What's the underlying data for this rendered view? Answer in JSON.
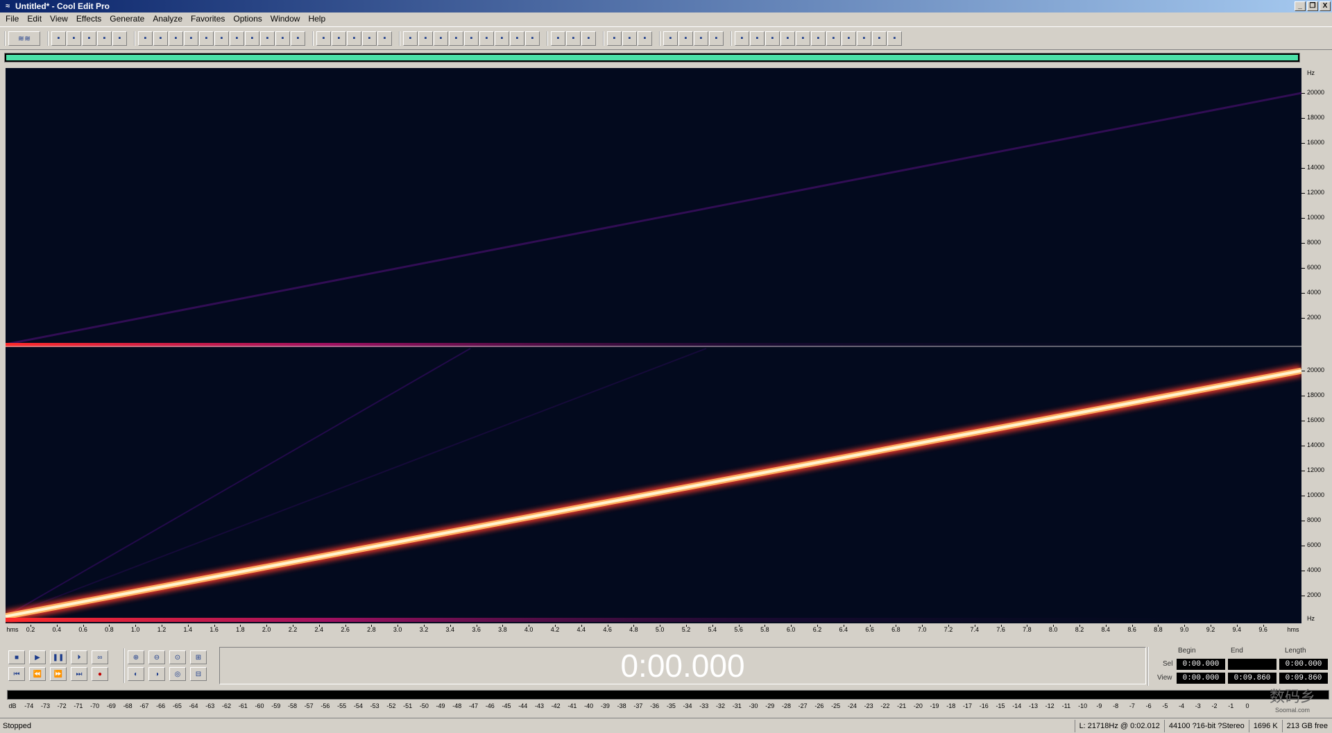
{
  "window": {
    "title": "Untitled* - Cool Edit Pro",
    "minimize_label": "_",
    "restore_label": "❐",
    "close_label": "X"
  },
  "menu": [
    "File",
    "Edit",
    "View",
    "Effects",
    "Generate",
    "Analyze",
    "Favorites",
    "Options",
    "Window",
    "Help"
  ],
  "toolbar_icons": [
    "waveform-view-icon",
    "new-file-icon",
    "open-file-icon",
    "save-icon",
    "save-all-icon",
    "close-file-icon",
    "undo-icon",
    "redo-icon",
    "cut-icon",
    "copy-icon",
    "paste-icon",
    "mix-paste-icon",
    "trim-icon",
    "select-all-icon",
    "zoom-selection-icon",
    "crop-icon",
    "play-selection-icon",
    "spectral-view-icon",
    "envelope-icon",
    "snap-icon",
    "grid-icon",
    "cue-icon",
    "marker-icon",
    "region-icon",
    "stretch-icon",
    "play-icon",
    "loop-icon",
    "time-icon",
    "frame-icon",
    "meter-icon",
    "monitor-icon",
    "script-icon",
    "batch-icon",
    "help-icon",
    "list-icon",
    "scan-icon",
    "find-icon",
    "mixer-icon",
    "eq-icon",
    "filter-icon",
    "noise-icon",
    "amplify-icon",
    "fade-icon",
    "normalize-icon",
    "delay-icon",
    "reverb-icon",
    "pitch-icon",
    "bend-icon",
    "sweep-icon",
    "invert-icon",
    "reverse-icon",
    "silence-icon"
  ],
  "frequency_scale": {
    "unit": "Hz",
    "top_channel": [
      "20000",
      "18000",
      "16000",
      "14000",
      "12000",
      "10000",
      "8000",
      "6000",
      "4000",
      "2000"
    ],
    "bottom_channel": [
      "20000",
      "18000",
      "16000",
      "14000",
      "12000",
      "10000",
      "8000",
      "6000",
      "4000",
      "2000"
    ]
  },
  "time_ruler": {
    "start_label": "hms",
    "end_label": "hms",
    "labels": [
      "0.2",
      "0.4",
      "0.6",
      "0.8",
      "1.0",
      "1.2",
      "1.4",
      "1.6",
      "1.8",
      "2.0",
      "2.2",
      "2.4",
      "2.6",
      "2.8",
      "3.0",
      "3.2",
      "3.4",
      "3.6",
      "3.8",
      "4.0",
      "4.2",
      "4.4",
      "4.6",
      "4.8",
      "5.0",
      "5.2",
      "5.4",
      "5.6",
      "5.8",
      "6.0",
      "6.2",
      "6.4",
      "6.6",
      "6.8",
      "7.0",
      "7.2",
      "7.4",
      "7.6",
      "7.8",
      "8.0",
      "8.2",
      "8.4",
      "8.6",
      "8.8",
      "9.0",
      "9.2",
      "9.4",
      "9.6"
    ]
  },
  "transport": {
    "row1": [
      "stop-icon",
      "play-icon",
      "pause-icon",
      "play-to-end-icon",
      "loop-icon"
    ],
    "row2": [
      "go-to-start-icon",
      "rewind-icon",
      "fast-forward-icon",
      "go-to-end-icon",
      "record-icon"
    ]
  },
  "zoom": {
    "row1": [
      "zoom-in-icon",
      "zoom-out-icon",
      "zoom-full-icon",
      "zoom-vertical-in-icon"
    ],
    "row2": [
      "zoom-left-icon",
      "zoom-right-icon",
      "zoom-selection-icon",
      "zoom-vertical-out-icon"
    ]
  },
  "time_display": "0:00.000",
  "selection": {
    "headers": {
      "begin": "Begin",
      "end": "End",
      "length": "Length"
    },
    "sel_label": "Sel",
    "view_label": "View",
    "sel": {
      "begin": "0:00.000",
      "end": "",
      "length": "0:00.000"
    },
    "view": {
      "begin": "0:00.000",
      "end": "0:09.860",
      "length": "0:09.860"
    }
  },
  "level_meter": {
    "labels": [
      "dB",
      "-74",
      "-73",
      "-72",
      "-71",
      "-70",
      "-69",
      "-68",
      "-67",
      "-66",
      "-65",
      "-64",
      "-63",
      "-62",
      "-61",
      "-60",
      "-59",
      "-58",
      "-57",
      "-56",
      "-55",
      "-54",
      "-53",
      "-52",
      "-51",
      "-50",
      "-49",
      "-48",
      "-47",
      "-46",
      "-45",
      "-44",
      "-43",
      "-42",
      "-41",
      "-40",
      "-39",
      "-38",
      "-37",
      "-36",
      "-35",
      "-34",
      "-33",
      "-32",
      "-31",
      "-30",
      "-29",
      "-28",
      "-27",
      "-26",
      "-25",
      "-24",
      "-23",
      "-22",
      "-21",
      "-20",
      "-19",
      "-18",
      "-17",
      "-16",
      "-15",
      "-14",
      "-13",
      "-12",
      "-11",
      "-10",
      "-9",
      "-8",
      "-7",
      "-6",
      "-5",
      "-4",
      "-3",
      "-2",
      "-1",
      "0"
    ]
  },
  "status": {
    "state": "Stopped",
    "cursor": "L: 21718Hz @   0:02.012",
    "format": "44100 ?16-bit ?Stereo",
    "size": "1696 K",
    "free": "213 GB free"
  },
  "watermark": {
    "text": "数码乡",
    "sub": "Soomal.com"
  },
  "colors": {
    "spectral_bg": "#030a1e",
    "sweep_hot": "#ffe6a0",
    "sweep_warm": "#ff6a3a",
    "sweep_cool": "#4a0e6a",
    "overview_range": "#4ce0a8"
  }
}
